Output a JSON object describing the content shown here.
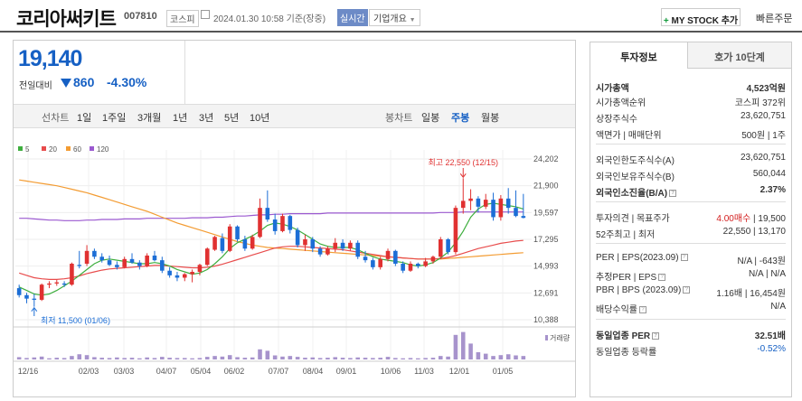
{
  "header": {
    "company_name": "코리아써키트",
    "code": "007810",
    "market": "코스피",
    "datetime": "2024.01.30 10:58 기준(장중)",
    "realtime": "실시간",
    "company_info": "기업개요",
    "my_stock": "MY STOCK 추가",
    "my_stock_plus": "+",
    "quick_order": "빠른주문"
  },
  "price": {
    "current": "19,140",
    "change_label": "전일대비",
    "change": "860",
    "change_pct": "-4.30%"
  },
  "toolbar": {
    "line_chart_label": "선차트",
    "periods": [
      "1일",
      "1주일",
      "3개월",
      "1년",
      "3년",
      "5년",
      "10년"
    ],
    "candle_label": "봉차트",
    "candle_periods": [
      "일봉",
      "주봉",
      "월봉"
    ],
    "selected_candle": "주봉"
  },
  "chart_data": {
    "type": "candlestick",
    "legend": [
      "5",
      "20",
      "60",
      "120"
    ],
    "legend_colors": [
      "#3eae3e",
      "#e84c4c",
      "#f39c33",
      "#9b59d0"
    ],
    "y_ticks": [
      "24,202",
      "21,900",
      "19,597",
      "17,295",
      "14,993",
      "12,691",
      "10,388"
    ],
    "ylim": [
      10388,
      24202
    ],
    "x_ticks": [
      "12/16",
      "02/03",
      "03/03",
      "04/07",
      "05/04",
      "06/02",
      "07/07",
      "08/04",
      "09/01",
      "10/06",
      "11/03",
      "12/01",
      "01/05"
    ],
    "max_label": "최고 22,550 (12/15)",
    "min_label": "최저 11,500 (01/06)",
    "volume_label": "거래량",
    "up_color": "#e03131",
    "down_color": "#1c6ed6",
    "candles": [
      {
        "o": 13100,
        "h": 13400,
        "l": 12300,
        "c": 12500
      },
      {
        "o": 12500,
        "h": 12700,
        "l": 11800,
        "c": 12200
      },
      {
        "o": 12200,
        "h": 12600,
        "l": 11500,
        "c": 12100
      },
      {
        "o": 12100,
        "h": 13500,
        "l": 12000,
        "c": 13400
      },
      {
        "o": 13400,
        "h": 13700,
        "l": 13100,
        "c": 13500
      },
      {
        "o": 13500,
        "h": 13800,
        "l": 13300,
        "c": 13600
      },
      {
        "o": 13500,
        "h": 13700,
        "l": 13200,
        "c": 13400
      },
      {
        "o": 13400,
        "h": 15300,
        "l": 13300,
        "c": 15200
      },
      {
        "o": 15100,
        "h": 16300,
        "l": 14800,
        "c": 15000
      },
      {
        "o": 15200,
        "h": 16800,
        "l": 15000,
        "c": 16300
      },
      {
        "o": 16300,
        "h": 16500,
        "l": 15600,
        "c": 15800
      },
      {
        "o": 15800,
        "h": 16100,
        "l": 15300,
        "c": 15500
      },
      {
        "o": 15500,
        "h": 15900,
        "l": 15000,
        "c": 15100
      },
      {
        "o": 15100,
        "h": 15400,
        "l": 14700,
        "c": 14900
      },
      {
        "o": 14900,
        "h": 15800,
        "l": 14800,
        "c": 15600
      },
      {
        "o": 15600,
        "h": 16100,
        "l": 15200,
        "c": 15300
      },
      {
        "o": 15300,
        "h": 15500,
        "l": 14700,
        "c": 15000
      },
      {
        "o": 15000,
        "h": 16100,
        "l": 14900,
        "c": 15900
      },
      {
        "o": 15900,
        "h": 16300,
        "l": 15400,
        "c": 15500
      },
      {
        "o": 15500,
        "h": 15800,
        "l": 14400,
        "c": 14600
      },
      {
        "o": 14600,
        "h": 14900,
        "l": 14000,
        "c": 14200
      },
      {
        "o": 14200,
        "h": 14500,
        "l": 13700,
        "c": 14000
      },
      {
        "o": 14000,
        "h": 14400,
        "l": 13700,
        "c": 14300
      },
      {
        "o": 14300,
        "h": 14700,
        "l": 13600,
        "c": 14500
      },
      {
        "o": 14500,
        "h": 15200,
        "l": 14200,
        "c": 15100
      },
      {
        "o": 15100,
        "h": 16600,
        "l": 15000,
        "c": 16500
      },
      {
        "o": 16400,
        "h": 17600,
        "l": 16300,
        "c": 17500
      },
      {
        "o": 17400,
        "h": 17800,
        "l": 16100,
        "c": 16300
      },
      {
        "o": 16300,
        "h": 18600,
        "l": 16200,
        "c": 18400
      },
      {
        "o": 18400,
        "h": 18500,
        "l": 17100,
        "c": 17300
      },
      {
        "o": 17300,
        "h": 17600,
        "l": 16300,
        "c": 16500
      },
      {
        "o": 16500,
        "h": 17700,
        "l": 16400,
        "c": 17500
      },
      {
        "o": 17500,
        "h": 20800,
        "l": 17400,
        "c": 20000
      },
      {
        "o": 20000,
        "h": 21500,
        "l": 18800,
        "c": 19000
      },
      {
        "o": 19000,
        "h": 19500,
        "l": 17700,
        "c": 18000
      },
      {
        "o": 18000,
        "h": 19500,
        "l": 17900,
        "c": 19300
      },
      {
        "o": 19300,
        "h": 19400,
        "l": 17800,
        "c": 18100
      },
      {
        "o": 18100,
        "h": 18300,
        "l": 16600,
        "c": 16800
      },
      {
        "o": 16800,
        "h": 17700,
        "l": 16300,
        "c": 17300
      },
      {
        "o": 17300,
        "h": 17500,
        "l": 16200,
        "c": 16500
      },
      {
        "o": 16500,
        "h": 16700,
        "l": 15800,
        "c": 16000
      },
      {
        "o": 16000,
        "h": 16700,
        "l": 15900,
        "c": 16500
      },
      {
        "o": 16500,
        "h": 17400,
        "l": 16200,
        "c": 17000
      },
      {
        "o": 17000,
        "h": 17300,
        "l": 16300,
        "c": 16500
      },
      {
        "o": 16500,
        "h": 17200,
        "l": 16300,
        "c": 17000
      },
      {
        "o": 17000,
        "h": 17200,
        "l": 15600,
        "c": 15800
      },
      {
        "o": 15800,
        "h": 16300,
        "l": 15300,
        "c": 15500
      },
      {
        "o": 15500,
        "h": 15700,
        "l": 14700,
        "c": 14900
      },
      {
        "o": 14900,
        "h": 15800,
        "l": 14700,
        "c": 15600
      },
      {
        "o": 15600,
        "h": 16500,
        "l": 15400,
        "c": 16300
      },
      {
        "o": 16300,
        "h": 16400,
        "l": 15000,
        "c": 15200
      },
      {
        "o": 15200,
        "h": 15400,
        "l": 14400,
        "c": 14600
      },
      {
        "o": 14600,
        "h": 15400,
        "l": 14500,
        "c": 15200
      },
      {
        "o": 15200,
        "h": 15300,
        "l": 14800,
        "c": 15000
      },
      {
        "o": 15000,
        "h": 15700,
        "l": 14900,
        "c": 15400
      },
      {
        "o": 15400,
        "h": 15900,
        "l": 15200,
        "c": 15800
      },
      {
        "o": 15800,
        "h": 17500,
        "l": 15600,
        "c": 17300
      },
      {
        "o": 17300,
        "h": 17400,
        "l": 16000,
        "c": 16200
      },
      {
        "o": 16200,
        "h": 20200,
        "l": 16000,
        "c": 20000
      },
      {
        "o": 20000,
        "h": 22550,
        "l": 19500,
        "c": 20600
      },
      {
        "o": 20600,
        "h": 21600,
        "l": 19800,
        "c": 20800
      },
      {
        "o": 20800,
        "h": 21000,
        "l": 19600,
        "c": 20100
      },
      {
        "o": 20100,
        "h": 21200,
        "l": 19900,
        "c": 20700
      },
      {
        "o": 20700,
        "h": 21300,
        "l": 18900,
        "c": 19200
      },
      {
        "o": 19200,
        "h": 21100,
        "l": 18900,
        "c": 20800
      },
      {
        "o": 20800,
        "h": 21700,
        "l": 19500,
        "c": 20000
      },
      {
        "o": 20000,
        "h": 21500,
        "l": 19200,
        "c": 19300
      },
      {
        "o": 19300,
        "h": 21200,
        "l": 19100,
        "c": 19140
      }
    ],
    "ma120": [
      19100,
      19100,
      19050,
      19000,
      18950,
      18950,
      18900,
      18900,
      18900,
      18950,
      18950,
      19000,
      19000,
      19000,
      19050,
      19050,
      19050,
      19100,
      19100,
      19100,
      19100,
      19100,
      19100,
      19150,
      19150,
      19150,
      19200,
      19200,
      19250,
      19300,
      19300,
      19350,
      19400,
      19400,
      19450,
      19450,
      19500,
      19500,
      19500,
      19500,
      19500,
      19550,
      19550,
      19550,
      19550,
      19550,
      19550,
      19550,
      19550,
      19550,
      19550,
      19550,
      19550,
      19550,
      19550,
      19550,
      19600,
      19600,
      19600,
      19650,
      19650,
      19650,
      19650,
      19650,
      19650,
      19650,
      19650,
      19650
    ],
    "ma60": [
      22400,
      22300,
      22200,
      22100,
      22000,
      21900,
      21750,
      21600,
      21450,
      21300,
      21100,
      20900,
      20700,
      20500,
      20300,
      20100,
      19900,
      19700,
      19450,
      19200,
      18950,
      18700,
      18500,
      18300,
      18100,
      17900,
      17700,
      17500,
      17300,
      17100,
      16950,
      16800,
      16700,
      16600,
      16550,
      16500,
      16450,
      16400,
      16350,
      16300,
      16250,
      16200,
      16150,
      16100,
      16050,
      16000,
      15950,
      15900,
      15850,
      15800,
      15750,
      15700,
      15650,
      15600,
      15600,
      15600,
      15600,
      15650,
      15700,
      15750,
      15800,
      15850,
      15900,
      15950,
      16000,
      16050,
      16100,
      16150
    ],
    "ma20": [
      14400,
      14200,
      14000,
      13900,
      13850,
      13850,
      13900,
      14000,
      14150,
      14350,
      14500,
      14650,
      14750,
      14800,
      14850,
      14900,
      14950,
      15000,
      15050,
      15050,
      15000,
      14950,
      14900,
      14850,
      14850,
      14900,
      15000,
      15150,
      15350,
      15550,
      15750,
      15950,
      16150,
      16350,
      16550,
      16650,
      16700,
      16700,
      16650,
      16600,
      16550,
      16500,
      16450,
      16400,
      16300,
      16200,
      16100,
      16000,
      15900,
      15800,
      15750,
      15700,
      15650,
      15600,
      15600,
      15600,
      15650,
      15750,
      15900,
      16100,
      16300,
      16500,
      16650,
      16800,
      16950,
      17050,
      17150,
      17200
    ],
    "ma5": [
      13200,
      12900,
      12600,
      12500,
      12600,
      12900,
      13300,
      13700,
      14200,
      14700,
      15200,
      15500,
      15600,
      15500,
      15400,
      15300,
      15200,
      15200,
      15300,
      15200,
      15000,
      14700,
      14500,
      14300,
      14400,
      14700,
      15200,
      15800,
      16500,
      17000,
      17300,
      17600,
      18000,
      18500,
      18700,
      18600,
      18400,
      18100,
      17700,
      17300,
      16900,
      16700,
      16600,
      16600,
      16600,
      16400,
      16100,
      15800,
      15600,
      15500,
      15400,
      15300,
      15100,
      15000,
      15100,
      15300,
      15700,
      16200,
      17000,
      18000,
      19200,
      19900,
      20300,
      20400,
      20300,
      20200,
      20100,
      19900
    ],
    "volume": [
      0.08,
      0.05,
      0.07,
      0.1,
      0.04,
      0.06,
      0.05,
      0.12,
      0.18,
      0.15,
      0.08,
      0.06,
      0.05,
      0.07,
      0.05,
      0.06,
      0.04,
      0.07,
      0.05,
      0.09,
      0.06,
      0.05,
      0.05,
      0.04,
      0.05,
      0.09,
      0.12,
      0.1,
      0.15,
      0.08,
      0.06,
      0.07,
      0.35,
      0.3,
      0.14,
      0.1,
      0.12,
      0.09,
      0.06,
      0.07,
      0.05,
      0.06,
      0.08,
      0.06,
      0.05,
      0.07,
      0.06,
      0.05,
      0.06,
      0.09,
      0.05,
      0.04,
      0.05,
      0.04,
      0.05,
      0.06,
      0.12,
      0.1,
      0.85,
      0.95,
      0.55,
      0.25,
      0.2,
      0.12,
      0.15,
      0.18,
      0.14,
      0.12
    ]
  },
  "side": {
    "tab_invest": "투자정보",
    "tab_hoga": "호가 10단계",
    "rows": [
      {
        "k": "시가총액",
        "v": "4,523억원"
      },
      {
        "k": "시가총액순위",
        "v": "코스피 372위"
      },
      {
        "k": "상장주식수",
        "v": "23,620,751"
      },
      {
        "k": "액면가 | 매매단위",
        "v": "500원 | 1주"
      },
      {
        "k": "외국인한도주식수(A)",
        "v": "23,620,751"
      },
      {
        "k": "외국인보유주식수(B)",
        "v": "560,044"
      },
      {
        "k": "외국인소진율(B/A)",
        "v": "2.37%"
      },
      {
        "k": "투자의견 | 목표주가",
        "v1": "4.00매수",
        "v2": " | 19,500"
      },
      {
        "k": "52주최고 | 최저",
        "v": "22,550 | 13,170"
      },
      {
        "k": "PER | EPS(2023.09)",
        "v": "N/A | -643원"
      },
      {
        "k": "추정PER | EPS",
        "v": "N/A | N/A"
      },
      {
        "k": "PBR | BPS (2023.09)",
        "v": "1.16배 | 16,454원"
      },
      {
        "k": "배당수익률",
        "v": "N/A"
      },
      {
        "k": "동일업종 PER",
        "v": "32.51배"
      },
      {
        "k": "동일업종 등락률",
        "v": "-0.52%"
      }
    ]
  }
}
